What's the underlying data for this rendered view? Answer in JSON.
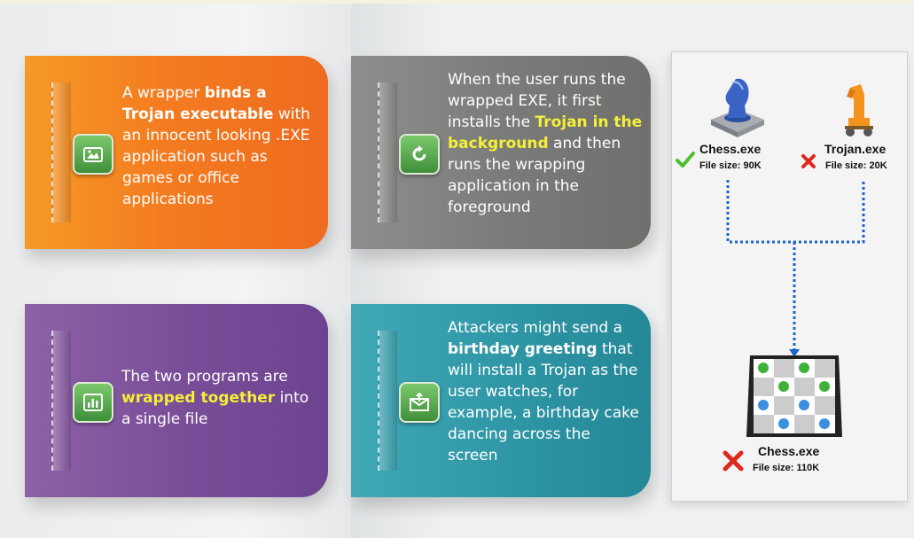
{
  "cards": [
    {
      "color": "#f47c20",
      "icon": "image-folder-icon",
      "segments": [
        {
          "t": "A wrapper "
        },
        {
          "t": "binds a Trojan executable",
          "s": "bold"
        },
        {
          "t": " with an innocent looking .EXE application such as games or office applications"
        }
      ]
    },
    {
      "color": "#7b7c79",
      "icon": "refresh-icon",
      "segments": [
        {
          "t": "When the user runs the wrapped EXE, it first installs the "
        },
        {
          "t": "Trojan in the background",
          "s": "hl"
        },
        {
          "t": " and then runs the wrapping application in the foreground"
        }
      ]
    },
    {
      "color": "#7a4e99",
      "icon": "chart-icon",
      "segments": [
        {
          "t": "The two programs are "
        },
        {
          "t": "wrapped together",
          "s": "hl"
        },
        {
          "t": " into a single file"
        }
      ]
    },
    {
      "color": "#2f97a6",
      "icon": "mail-icon",
      "segments": [
        {
          "t": "Attackers might send a "
        },
        {
          "t": "birthday greeting",
          "s": "bold"
        },
        {
          "t": " that will install a Trojan as the user watches, for example, a birthday cake dancing across the screen"
        }
      ]
    }
  ],
  "diagram": {
    "chess": {
      "name": "Chess.exe",
      "size": "File size: 90K",
      "status": "check-icon"
    },
    "trojan": {
      "name": "Trojan.exe",
      "size": "File size: 20K",
      "status": "x-icon"
    },
    "result": {
      "name": "Chess.exe",
      "size": "File size: 110K",
      "status": "x-icon"
    }
  }
}
